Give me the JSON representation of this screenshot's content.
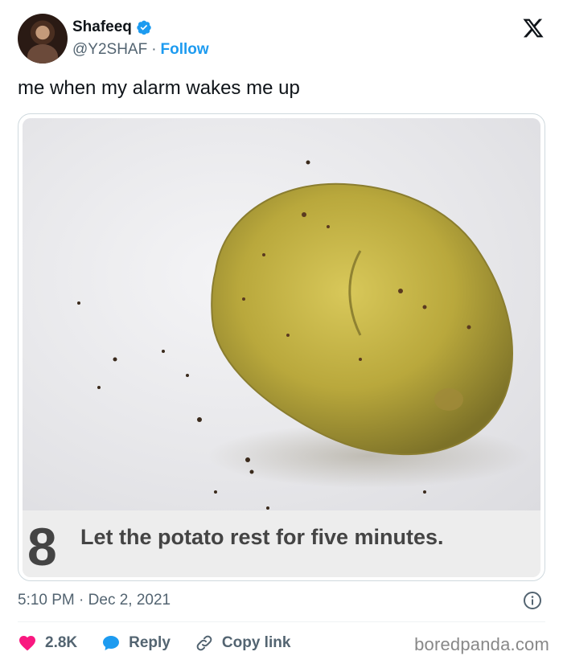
{
  "header": {
    "name": "Shafeeq",
    "handle": "@Y2SHAF",
    "separator": "·",
    "follow_label": "Follow"
  },
  "tweet": {
    "text": "me when my alarm wakes me up",
    "time": "5:10 PM",
    "meta_separator": "·",
    "date": "Dec 2, 2021"
  },
  "media": {
    "step_number": "8",
    "step_text": "Let the potato rest for five minutes."
  },
  "actions": {
    "likes": "2.8K",
    "reply_label": "Reply",
    "copy_link_label": "Copy link"
  },
  "watermark": "boredpanda.com",
  "colors": {
    "accent": "#1d9bf0",
    "like": "#f91880",
    "text": "#0f1419",
    "muted": "#536471"
  },
  "icons": {
    "verified": "verified-badge-icon",
    "brand": "x-logo-icon",
    "info": "info-icon",
    "like": "heart-icon",
    "reply": "speech-bubble-icon",
    "copy": "link-icon"
  }
}
